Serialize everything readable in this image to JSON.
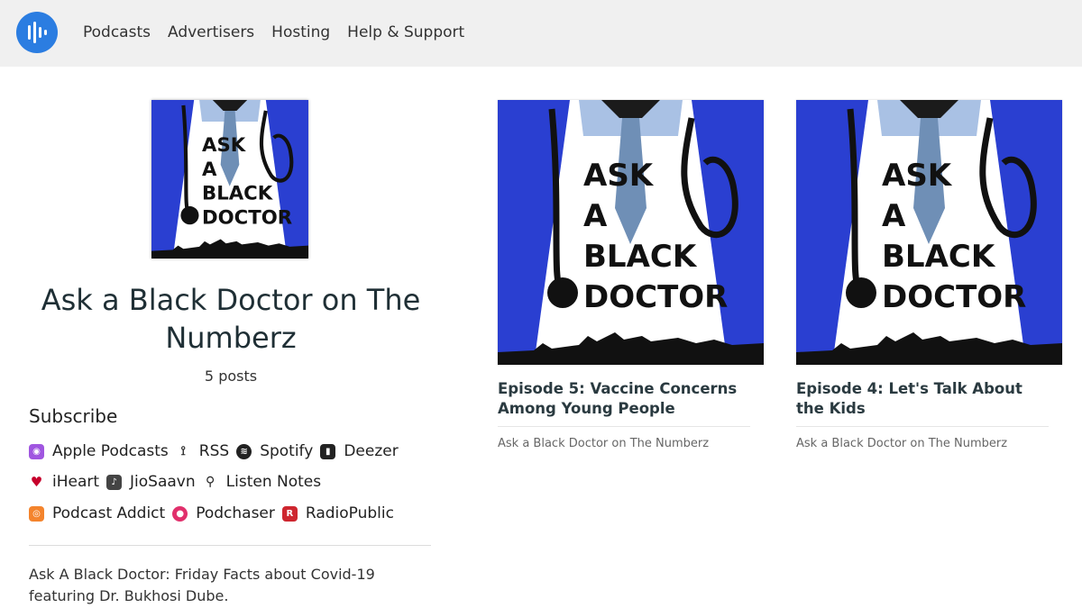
{
  "nav": {
    "items": [
      "Podcasts",
      "Advertisers",
      "Hosting",
      "Help & Support"
    ]
  },
  "podcast": {
    "cover_lines": [
      "ASK",
      "A",
      "BLACK",
      "DOCTOR"
    ],
    "title": "Ask a Black Doctor on The Numberz",
    "posts": "5 posts"
  },
  "subscribe": {
    "heading": "Subscribe",
    "rows": [
      [
        {
          "label": "Apple Podcasts",
          "icon": "apple-podcasts-icon",
          "color": "#a056e0"
        },
        {
          "label": "RSS",
          "icon": "rss-icon",
          "color": "#222222"
        },
        {
          "label": "Spotify",
          "icon": "spotify-icon",
          "color": "#222222"
        },
        {
          "label": "Deezer",
          "icon": "deezer-icon",
          "color": "#222222"
        }
      ],
      [
        {
          "label": "iHeart",
          "icon": "iheart-icon",
          "color": "#c6002b"
        },
        {
          "label": "JioSaavn",
          "icon": "jiosaavn-icon",
          "color": "#333333"
        },
        {
          "label": "Listen Notes",
          "icon": "listen-notes-icon",
          "color": "#222222"
        }
      ],
      [
        {
          "label": "Podcast Addict",
          "icon": "podcast-addict-icon",
          "color": "#f4842d"
        },
        {
          "label": "Podchaser",
          "icon": "podchaser-icon",
          "color": "#e1306c"
        },
        {
          "label": "RadioPublic",
          "icon": "radiopublic-icon",
          "color": "#ce262f"
        }
      ]
    ]
  },
  "description": "Ask A Black Doctor: Friday Facts about Covid-19 featuring Dr. Bukhosi Dube.",
  "episodes": [
    {
      "title": "Episode 5: Vaccine Concerns Among Young People",
      "show": "Ask a Black Doctor on The Numberz"
    },
    {
      "title": "Episode 4: Let's Talk About the Kids",
      "show": "Ask a Black Doctor on The Numberz"
    }
  ],
  "colors": {
    "brand": "#2b7de1",
    "coat_blue": "#2a3fd1",
    "tie": "#6f8fb6",
    "collar": "#a9c1e4"
  }
}
